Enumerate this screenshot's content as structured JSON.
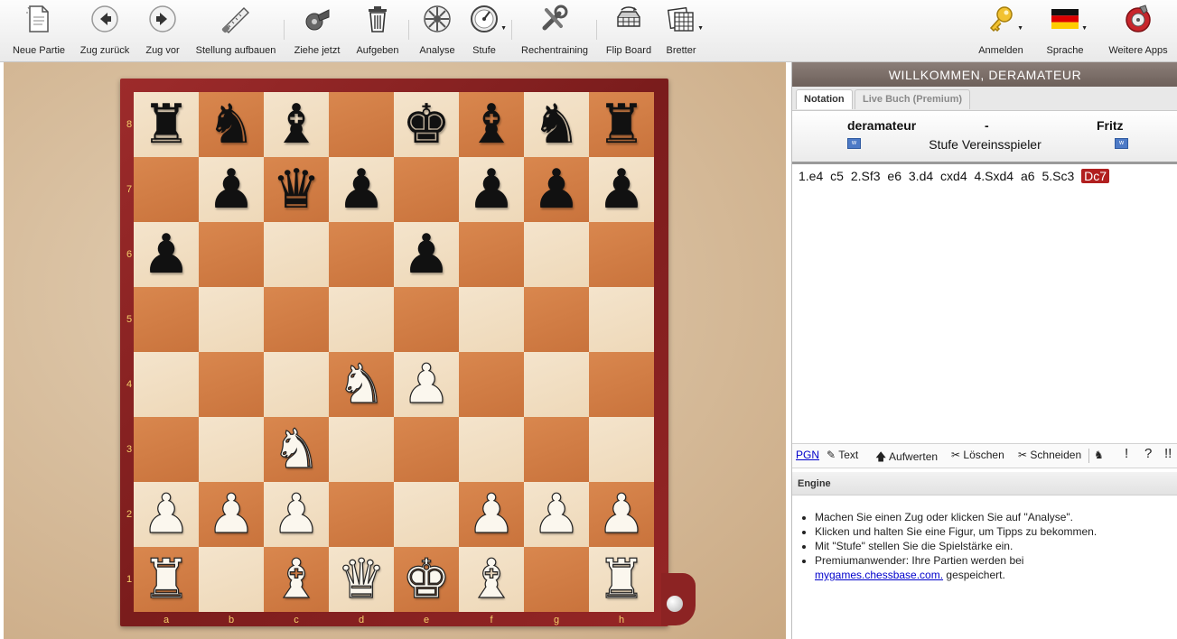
{
  "toolbar": {
    "neue_partie": "Neue Partie",
    "zug_zurueck": "Zug zurück",
    "zug_vor": "Zug vor",
    "stellung": "Stellung aufbauen",
    "ziehe_jetzt": "Ziehe jetzt",
    "aufgeben": "Aufgeben",
    "analyse": "Analyse",
    "stufe": "Stufe",
    "rechentraining": "Rechentraining",
    "flip_board": "Flip Board",
    "bretter": "Bretter",
    "anmelden": "Anmelden",
    "sprache": "Sprache",
    "weitere_apps": "Weitere Apps"
  },
  "board": {
    "ranks": [
      "8",
      "7",
      "6",
      "5",
      "4",
      "3",
      "2",
      "1"
    ],
    "files": [
      "a",
      "b",
      "c",
      "d",
      "e",
      "f",
      "g",
      "h"
    ],
    "position": [
      [
        "bR",
        "bN",
        "bB",
        "",
        "bK",
        "bB",
        "bN",
        "bR"
      ],
      [
        "",
        "bP",
        "bQ",
        "bP",
        "",
        "bP",
        "bP",
        "bP"
      ],
      [
        "bP",
        "",
        "",
        "",
        "bP",
        "",
        "",
        ""
      ],
      [
        "",
        "",
        "",
        "",
        "",
        "",
        "",
        ""
      ],
      [
        "",
        "",
        "",
        "wN",
        "wP",
        "",
        "",
        ""
      ],
      [
        "",
        "",
        "wN",
        "",
        "",
        "",
        "",
        ""
      ],
      [
        "wP",
        "wP",
        "wP",
        "",
        "",
        "wP",
        "wP",
        "wP"
      ],
      [
        "wR",
        "",
        "wB",
        "wQ",
        "wK",
        "wB",
        "",
        "wR"
      ]
    ]
  },
  "panel": {
    "welcome": "WILLKOMMEN, DERAMATEUR",
    "tabs": [
      "Notation",
      "Live Buch (Premium)"
    ],
    "white_player": "deramateur",
    "separator": "-",
    "black_player": "Fritz",
    "level": "Stufe Vereinsspieler",
    "moves": [
      "1.e4",
      "c5",
      "2.Sf3",
      "e6",
      "3.d4",
      "cxd4",
      "4.Sxd4",
      "a6",
      "5.Sc3"
    ],
    "current_move": "Dc7",
    "notebar": {
      "pgn": "PGN",
      "text": "Text",
      "aufwerten": "Aufwerten",
      "loeschen": "Löschen",
      "schneiden": "Schneiden",
      "excl": "!",
      "quest": "?",
      "dblexcl": "!!"
    },
    "engine_title": "Engine",
    "engine_hints": [
      "Machen Sie einen Zug oder klicken Sie auf \"Analyse\".",
      "Klicken und halten Sie eine Figur, um Tipps zu bekommen.",
      "Mit \"Stufe\" stellen Sie die Spielstärke ein.",
      "Premiumanwender: Ihre Partien werden bei"
    ],
    "engine_link": "mygames.chessbase.com.",
    "engine_tail": "gespeichert."
  }
}
